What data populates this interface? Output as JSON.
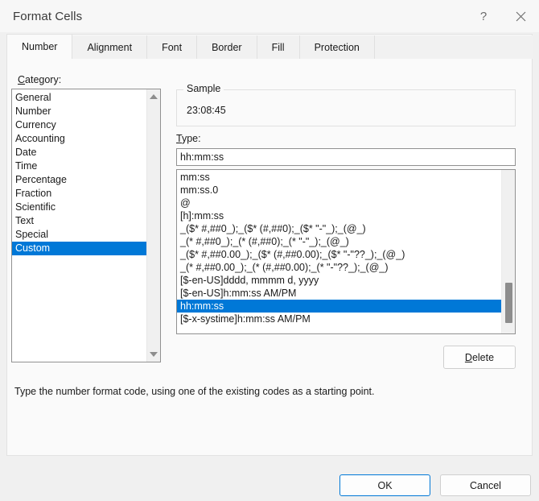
{
  "window": {
    "title": "Format Cells",
    "help_icon": "question-mark-icon",
    "close_icon": "close-x-icon"
  },
  "tabs": [
    {
      "label": "Number",
      "active": true
    },
    {
      "label": "Alignment",
      "active": false
    },
    {
      "label": "Font",
      "active": false
    },
    {
      "label": "Border",
      "active": false
    },
    {
      "label": "Fill",
      "active": false
    },
    {
      "label": "Protection",
      "active": false
    }
  ],
  "category": {
    "label_accel": "C",
    "label_rest": "ategory:",
    "items": [
      "General",
      "Number",
      "Currency",
      "Accounting",
      "Date",
      "Time",
      "Percentage",
      "Fraction",
      "Scientific",
      "Text",
      "Special",
      "Custom"
    ],
    "selected": "Custom",
    "scroll_up_icon": "scroll-arrow-up-icon",
    "scroll_down_icon": "scroll-arrow-down-icon"
  },
  "sample": {
    "legend": "Sample",
    "value": "23:08:45"
  },
  "type": {
    "label_accel": "T",
    "label_rest": "ype:",
    "input_value": "hh:mm:ss",
    "items": [
      "mm:ss",
      "mm:ss.0",
      "@",
      "[h]:mm:ss",
      "_($* #,##0_);_($* (#,##0);_($* \"-\"_);_(@_)",
      "_(* #,##0_);_(* (#,##0);_(* \"-\"_);_(@_)",
      "_($* #,##0.00_);_($* (#,##0.00);_($* \"-\"??_);_(@_)",
      "_(* #,##0.00_);_(* (#,##0.00);_(* \"-\"??_);_(@_)",
      "[$-en-US]dddd, mmmm d, yyyy",
      "[$-en-US]h:mm:ss AM/PM",
      "hh:mm:ss",
      "[$-x-systime]h:mm:ss AM/PM"
    ],
    "selected": "hh:mm:ss"
  },
  "delete": {
    "label_accel": "D",
    "label_rest": "elete"
  },
  "footer": {
    "help_text": "Type the number format code, using one of the existing codes as a starting point.",
    "ok_label": "OK",
    "cancel_label": "Cancel"
  },
  "colors": {
    "accent": "#0078d7",
    "window_bg": "#f0f0f0",
    "panel_bg": "#fafafa"
  }
}
